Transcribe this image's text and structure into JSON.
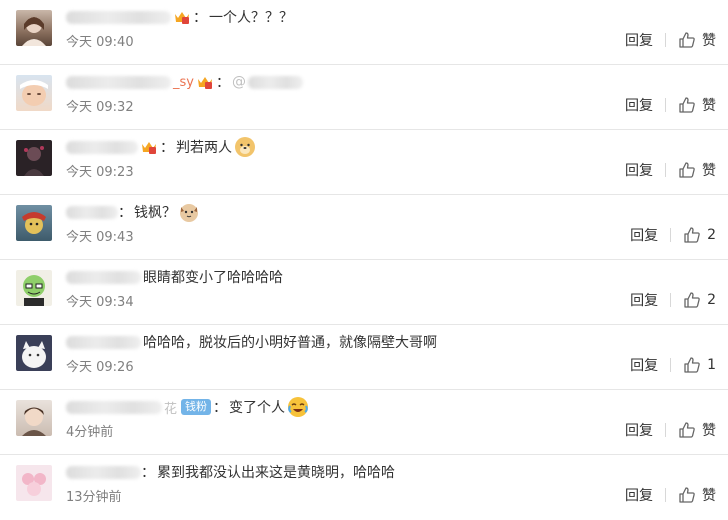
{
  "comments": [
    {
      "name_suffix": "",
      "text": "一个人？？？",
      "time": "今天 09:40",
      "reply_label": "回复",
      "like_label": "赞",
      "badge": ""
    },
    {
      "name_suffix": "_sy",
      "text": "@",
      "time": "今天 09:32",
      "reply_label": "回复",
      "like_label": "赞",
      "badge": ""
    },
    {
      "name_suffix": "",
      "text": "判若两人",
      "time": "今天 09:23",
      "reply_label": "回复",
      "like_label": "赞",
      "badge": ""
    },
    {
      "name_suffix": "",
      "text": "钱枫？",
      "time": "今天 09:43",
      "reply_label": "回复",
      "like_label": "2",
      "badge": ""
    },
    {
      "name_suffix": "",
      "text": "眼睛都变小了哈哈哈哈",
      "time": "今天 09:34",
      "reply_label": "回复",
      "like_label": "2",
      "badge": ""
    },
    {
      "name_suffix": "",
      "text": "哈哈哈，脱妆后的小明好普通，就像隔壁大哥啊",
      "time": "今天 09:26",
      "reply_label": "回复",
      "like_label": "1",
      "badge": ""
    },
    {
      "name_suffix": "花",
      "text": "变了个人",
      "time": "4分钟前",
      "reply_label": "回复",
      "like_label": "赞",
      "badge": "钱粉"
    },
    {
      "name_suffix": "",
      "text": "累到我都没认出来这是黄晓明，哈哈哈",
      "time": "13分钟前",
      "reply_label": "回复",
      "like_label": "赞",
      "badge": ""
    }
  ],
  "colors": {
    "username": "#eb7350",
    "time": "#808080",
    "divider": "#e6e6e6",
    "fan_badge": "#73b4e8"
  },
  "icons": {
    "like": "thumbs-up-icon",
    "crown": "vip-crown-icon"
  }
}
